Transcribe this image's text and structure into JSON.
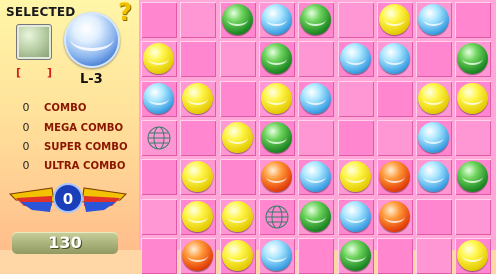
{
  "panel": {
    "selected_label": "SELECTED",
    "bracket_left": "[",
    "bracket_right": "]",
    "level": "L-3",
    "help_icon": "question-mark-icon",
    "combos": [
      {
        "count": "0",
        "label": "COMBO"
      },
      {
        "count": "0",
        "label": "MEGA COMBO"
      },
      {
        "count": "0",
        "label": "SUPER COMBO"
      },
      {
        "count": "0",
        "label": "ULTRA COMBO"
      }
    ],
    "multiplier": "0",
    "score": "130"
  },
  "colors": {
    "grid_bg": "#ffa7d8",
    "cell": "#ff86cf",
    "yellow": "#fff64a",
    "blue": "#3fa1e4",
    "green": "#1f8a25",
    "orange": "#ff9a3a"
  },
  "board": {
    "rows": [
      [
        "",
        "",
        "green",
        "blue",
        "green",
        "",
        "yellow",
        "blue",
        ""
      ],
      [
        "yellow",
        "",
        "",
        "green",
        "",
        "blue",
        "blue",
        "",
        "green"
      ],
      [
        "blue",
        "yellow",
        "",
        "yellow",
        "blue",
        "",
        "",
        "yellow",
        "yellow"
      ],
      [
        "target",
        "",
        "yellow",
        "green",
        "",
        "",
        "",
        "blue",
        ""
      ],
      [
        "",
        "yellow",
        "",
        "orange",
        "blue",
        "yellow",
        "orange",
        "blue",
        "green"
      ],
      [
        "",
        "yellow",
        "yellow",
        "target",
        "green",
        "blue",
        "orange",
        "",
        ""
      ],
      [
        "",
        "orange",
        "yellow",
        "blue",
        "",
        "green",
        "",
        "",
        "yellow"
      ]
    ]
  }
}
